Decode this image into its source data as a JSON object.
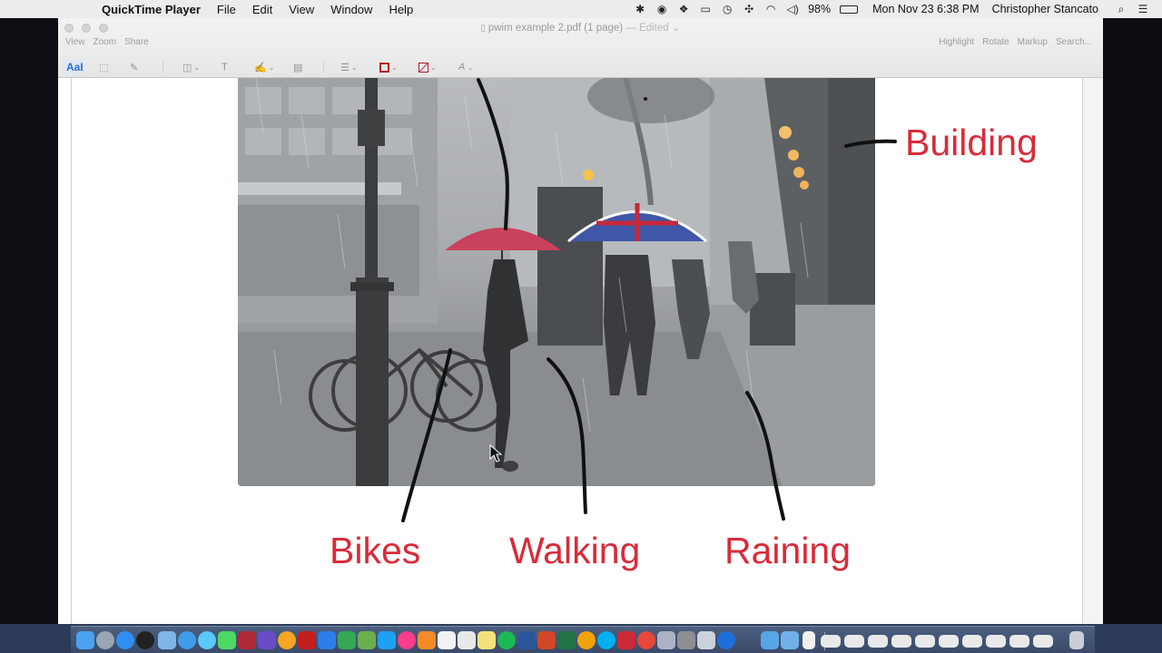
{
  "menubar": {
    "apple_glyph": "",
    "app_name": "QuickTime Player",
    "menus": [
      "File",
      "Edit",
      "View",
      "Window",
      "Help"
    ],
    "battery": "98%",
    "datetime": "Mon Nov 23  6:38 PM",
    "user": "Christopher Stancato",
    "status_icons": [
      "bluetooth-icon",
      "record-icon",
      "dropbox-icon",
      "airplay-icon",
      "time-machine-icon",
      "sync-icon",
      "wifi-icon",
      "volume-icon",
      "battery-icon"
    ]
  },
  "window": {
    "title": "pwim example 2.pdf (1 page)",
    "title_suffix": "— Edited ⌄",
    "toolbar_left": [
      "View",
      "Zoom",
      "Share"
    ],
    "toolbar_right": [
      "Highlight",
      "Rotate",
      "Markup",
      "Search..."
    ],
    "markup_text_tool": "AaI"
  },
  "document": {
    "labels": {
      "building": "Building",
      "bikes": "Bikes",
      "walking": "Walking",
      "raining": "Raining"
    },
    "label_color": "#d92b3a",
    "photo_subject": "rainy street with umbrellas, bicycles and pedestrians"
  },
  "dock": {
    "apps": [
      "finder-icon",
      "launchpad-icon",
      "app-store-icon",
      "dashboard-icon",
      "preview-icon",
      "safari-icon",
      "messages-icon",
      "facetime-icon",
      "photo-booth-icon",
      "imovie-icon",
      "photos-icon",
      "acrobat-icon",
      "dropbox-icon",
      "drive-icon",
      "maps-icon",
      "twitter-icon",
      "itunes-icon",
      "ibooks-icon",
      "calendar-icon",
      "textedit-icon",
      "notes-icon",
      "spotify-icon",
      "word-icon",
      "powerpoint-icon",
      "excel-icon",
      "outlook-icon",
      "skype-icon",
      "mail-icon",
      "chrome-icon",
      "screenshots-icon",
      "system-prefs-icon",
      "terminal-icon",
      "quicktime-icon"
    ],
    "stacks": [
      "applications-folder-icon",
      "documents-folder-icon",
      "file-icon",
      "screenshot-1-icon",
      "screenshot-2-icon",
      "screenshot-3-icon",
      "screenshot-4-icon",
      "screenshot-5-icon",
      "screenshot-6-icon",
      "screenshot-7-icon",
      "screenshot-8-icon",
      "screenshot-9-icon",
      "screenshot-10-icon",
      "trash-icon"
    ]
  }
}
